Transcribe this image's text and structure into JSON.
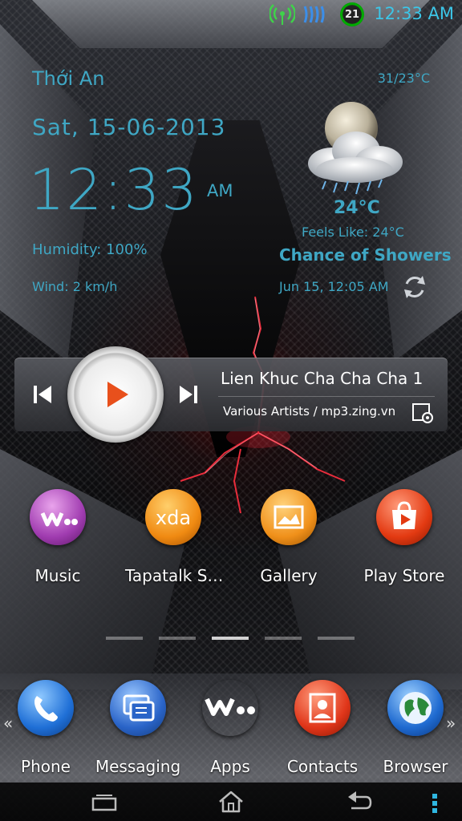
{
  "status_bar": {
    "time": "12:33 AM",
    "notification_badge": "21",
    "icons": [
      "hotspot-icon",
      "signal-waves-icon",
      "badge-icon"
    ]
  },
  "weather": {
    "location": "Thới An",
    "temp_range": "31/23°C",
    "date": "Sat, 15-06-2013",
    "time": "12:33",
    "ampm": "AM",
    "humidity": "Humidity: 100%",
    "wind": "Wind: 2 km/h",
    "temperature": "24°C",
    "feels_like": "Feels Like: 24°C",
    "condition": "Chance of Showers",
    "updated": "Jun 15, 12:05 AM",
    "icon": "night-showers-icon"
  },
  "music_player": {
    "title": "Lien Khuc Cha Cha Cha 1",
    "artist": "Various Artists / mp3.zing.vn",
    "controls": [
      "previous-icon",
      "play-icon",
      "next-icon",
      "settings-icon"
    ]
  },
  "apps": [
    {
      "label": "Music",
      "icon": "walkman-icon"
    },
    {
      "label": "Tapatalk S…",
      "icon": "xda-icon"
    },
    {
      "label": "Gallery",
      "icon": "gallery-icon"
    },
    {
      "label": "Play Store",
      "icon": "play-store-icon"
    }
  ],
  "dock": [
    {
      "label": "Phone",
      "icon": "phone-icon"
    },
    {
      "label": "Messaging",
      "icon": "messaging-icon"
    },
    {
      "label": "Apps",
      "icon": "walkman-apps-icon"
    },
    {
      "label": "Contacts",
      "icon": "contacts-icon"
    },
    {
      "label": "Browser",
      "icon": "globe-icon"
    }
  ],
  "dock_arrows": {
    "left": "«",
    "right": "»"
  },
  "pager": {
    "pages": 5,
    "active": 3
  },
  "colors": {
    "accent": "#3fa7c4",
    "clock": "#3cc6e8",
    "play_button": "#e8501c"
  }
}
